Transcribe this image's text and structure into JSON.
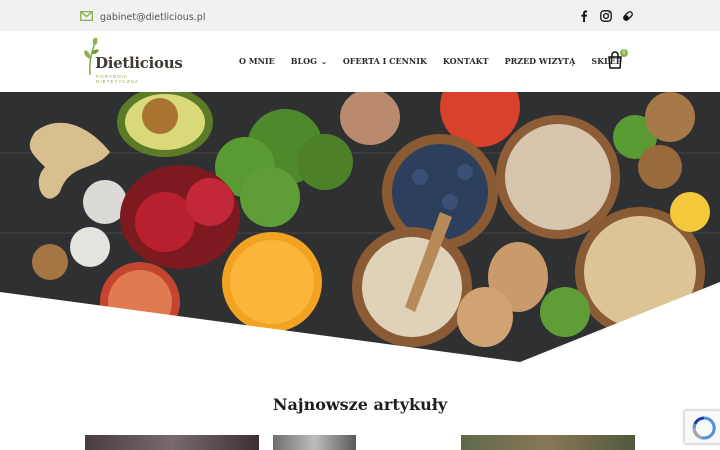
{
  "topbar": {
    "email": "gabinet@dietlicious.pl",
    "icons": [
      "mail-icon",
      "facebook-icon",
      "instagram-icon",
      "booksy-icon"
    ]
  },
  "logo": {
    "name": "Dietlicious",
    "subtitle": "PORADNIA DIETETYCZNA"
  },
  "nav": {
    "items": [
      {
        "label": "O MNIE"
      },
      {
        "label": "BLOG",
        "has_dropdown": true
      },
      {
        "label": "OFERTA I CENNIK"
      },
      {
        "label": "KONTAKT"
      },
      {
        "label": "PRZED WIZYTĄ"
      },
      {
        "label": "SKLEP"
      }
    ]
  },
  "cart": {
    "count": "0",
    "icon": "shopping-bag-icon"
  },
  "main": {
    "section_title": "Najnowsze artykuły"
  },
  "colors": {
    "brand_green": "#8db04b",
    "topbar_bg": "#f1f1f1",
    "text_dark": "#2b2b2b"
  }
}
